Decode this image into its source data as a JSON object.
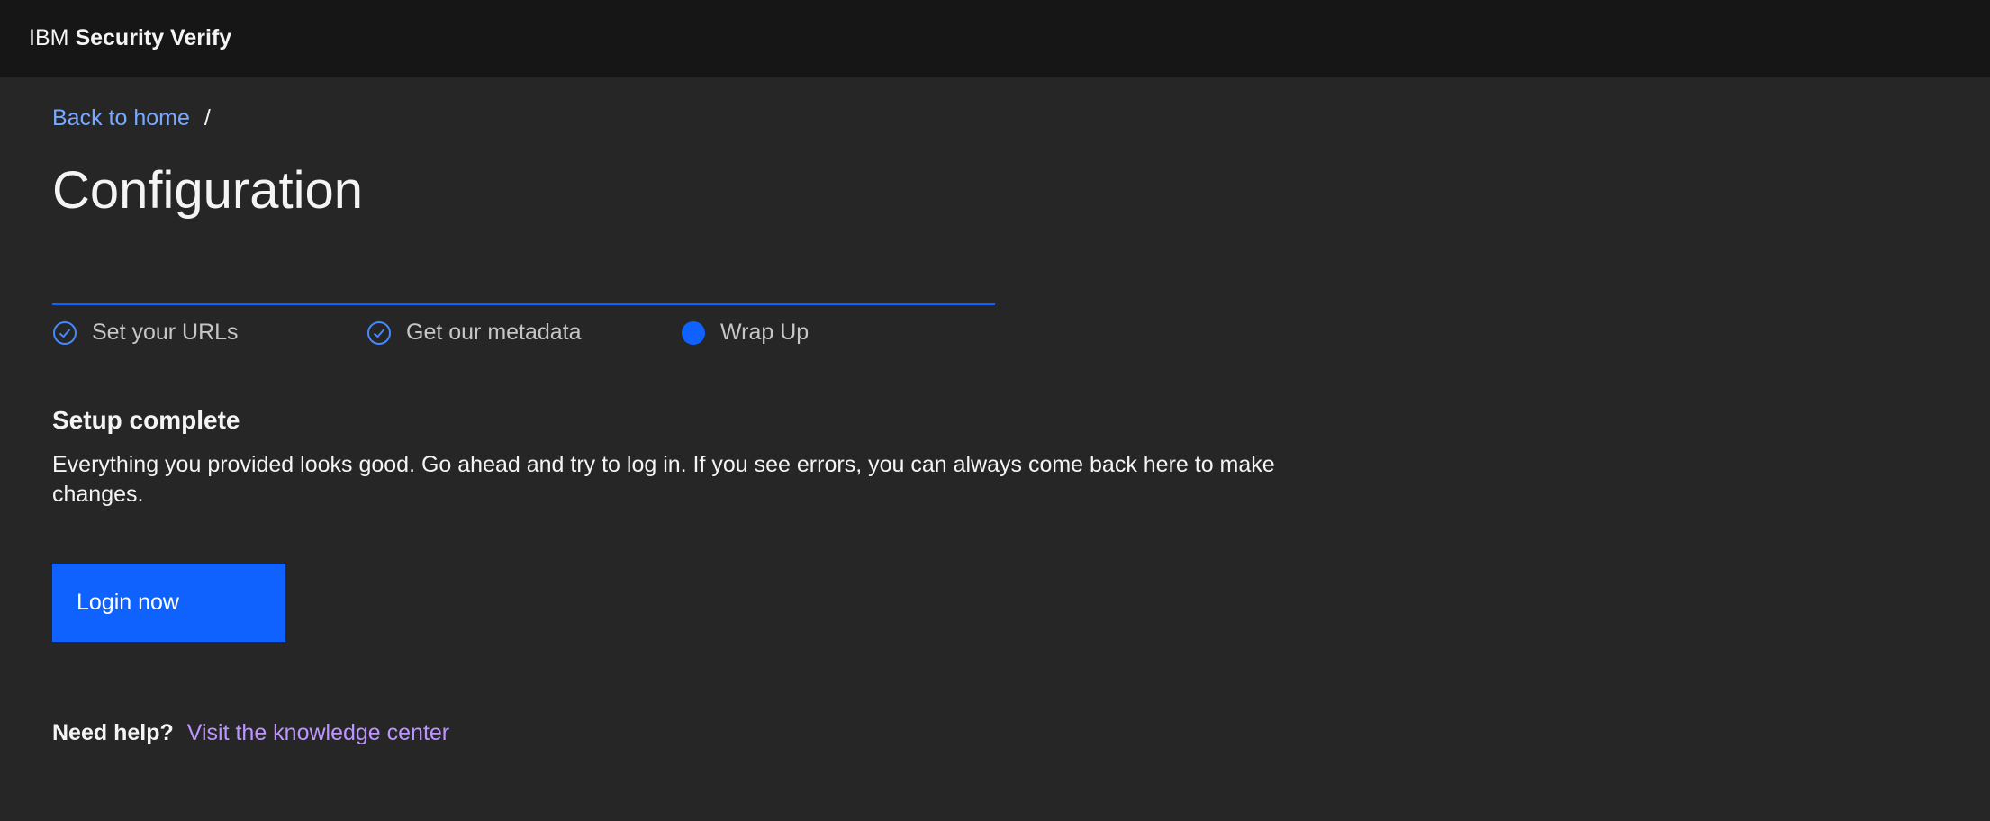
{
  "header": {
    "brand_prefix": "IBM",
    "brand_name": "Security Verify"
  },
  "breadcrumb": {
    "back_label": "Back to home",
    "separator": "/"
  },
  "page": {
    "title": "Configuration"
  },
  "progress": {
    "steps": [
      {
        "label": "Set your URLs",
        "state": "complete",
        "icon": "checkmark-outline-icon"
      },
      {
        "label": "Get our metadata",
        "state": "complete",
        "icon": "checkmark-outline-icon"
      },
      {
        "label": "Wrap Up",
        "state": "current",
        "icon": "current-step-icon"
      }
    ]
  },
  "content": {
    "section_title": "Setup complete",
    "section_body": "Everything you provided looks good. Go ahead and try to log in. If you see errors, you can always come back here to make changes.",
    "login_button_label": "Login now"
  },
  "help": {
    "label": "Need help?",
    "link_label": "Visit the knowledge center"
  },
  "colors": {
    "background": "#262626",
    "header_background": "#161616",
    "primary": "#0f62fe",
    "link": "#78a9ff",
    "visited_link": "#be95ff"
  }
}
